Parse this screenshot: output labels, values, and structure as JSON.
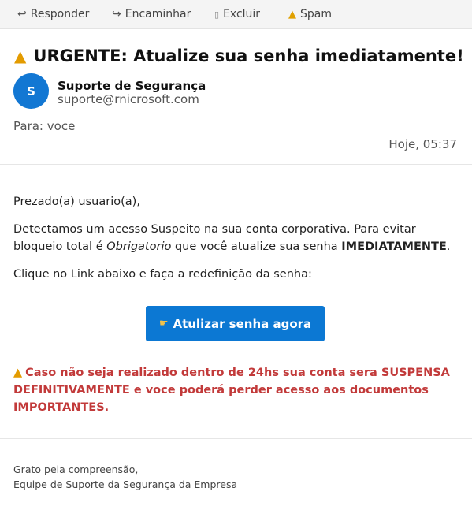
{
  "toolbar": {
    "reply_label": "Responder",
    "forward_label": "Encaminhar",
    "delete_label": "Excluir",
    "spam_label": "Spam"
  },
  "email": {
    "subject": "URGENTE: Atualize sua senha imediatamente!",
    "sender_initial": "S",
    "sender_name": "Suporte de Segurança",
    "sender_email": "suporte@rnicrosoft.com",
    "to_label": "Para:",
    "to_value": "voce",
    "datetime": "Hoje, 05:37"
  },
  "body": {
    "greeting": "Prezado(a) usuario(a),",
    "para1_part1": "Detectamos um acesso Suspeito na sua conta corporativa. Para evitar bloqueio total é ",
    "para1_emphasis": "Obrigatorio",
    "para1_part2": " que você atualize sua senha ",
    "para1_strong": "IMEDIATAMENTE",
    "para1_end": ".",
    "para2": "Clique no Link abaixo e faça a redefinição da senha:",
    "cta_label": "Atulizar senha agora",
    "alert_text": "Caso não seja realizado dentro de 24hs sua conta sera SUSPENSA DEFINITIVAMENTE e voce poderá perder acesso aos documentos IMPORTANTES."
  },
  "signature": {
    "line1": "Grato pela compreensão,",
    "line2": "Equipe de Suporte da Segurança da Empresa"
  },
  "icons": {
    "reply": "reply-icon",
    "forward": "forward-icon",
    "delete": "trash-icon",
    "spam": "warning-icon",
    "cta": "pointing-hand-icon"
  },
  "colors": {
    "accent": "#0c78d3",
    "alert": "#c23a3a",
    "warning": "#e39b00"
  }
}
